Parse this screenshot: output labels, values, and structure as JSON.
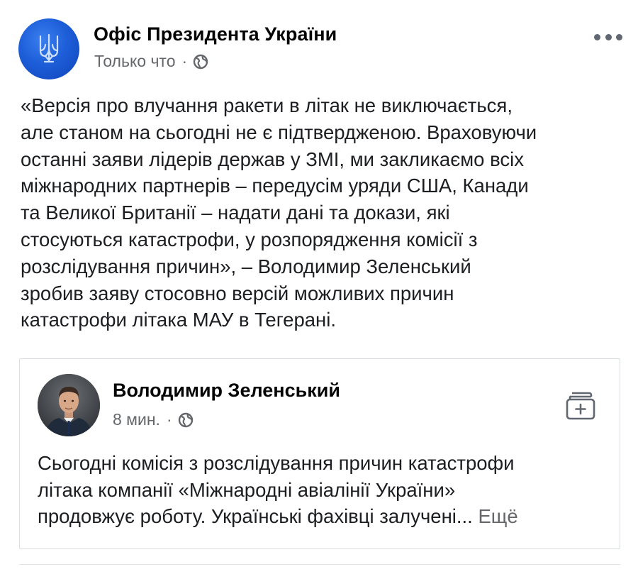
{
  "post": {
    "author": "Офіс Президента України",
    "timestamp": "Только что",
    "privacy_icon": "globe-icon",
    "more_icon": "more-options-icon",
    "text": "«Версія про влучання ракети в літак не виключається,\nале станом на сьогодні не є підтвердженою. Враховуючи\nостанні заяви лідерів держав у ЗМІ, ми закликаємо всіх\nміжнародних партнерів – передусім уряди США, Канади\nта Великої Британії – надати дані та докази, які\nстосуються катастрофи, у розпорядження комісії з\nрозслідування причин», – Володимир Зеленський\nзробив заяву стосовно версій можливих причин\nкатастрофи літака МАУ в Тегерані."
  },
  "shared": {
    "author": "Володимир Зеленський",
    "timestamp": "8 мин.",
    "privacy_icon": "globe-icon",
    "save_icon": "save-post-icon",
    "text": "Сьогодні комісія з розслідування причин катастрофи\nлітака компанії «Міжнародні авіалінії України»\nпродовжує роботу. Українські фахівці залучені...",
    "see_more": "Ещё"
  },
  "colors": {
    "avatar_blue": "#1d5ed8",
    "secondary_text": "#65676b",
    "border": "#dadde1"
  }
}
